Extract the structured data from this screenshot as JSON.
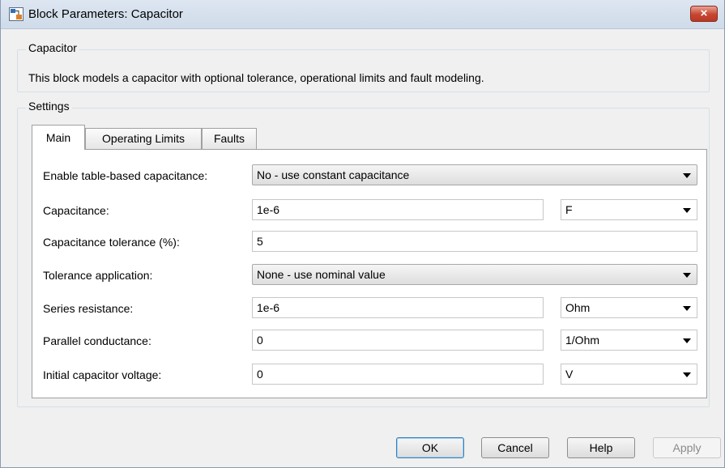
{
  "window": {
    "title": "Block Parameters: Capacitor",
    "close_label": "×"
  },
  "block_group": {
    "legend": "Capacitor",
    "description": "This block models a capacitor with optional tolerance, operational limits and fault modeling."
  },
  "settings_group": {
    "legend": "Settings"
  },
  "tabs": [
    {
      "label": "Main",
      "active": true
    },
    {
      "label": "Operating Limits",
      "active": false
    },
    {
      "label": "Faults",
      "active": false
    }
  ],
  "params": {
    "table_based": {
      "label": "Enable table-based capacitance:",
      "value": "No - use constant capacitance"
    },
    "capacitance": {
      "label": "Capacitance:",
      "value": "1e-6",
      "unit": "F"
    },
    "tolerance": {
      "label": "Capacitance tolerance (%):",
      "value": "5"
    },
    "tolerance_application": {
      "label": "Tolerance application:",
      "value": "None - use nominal value"
    },
    "series_resistance": {
      "label": "Series resistance:",
      "value": "1e-6",
      "unit": "Ohm"
    },
    "parallel_conductance": {
      "label": "Parallel conductance:",
      "value": "0",
      "unit": "1/Ohm"
    },
    "initial_voltage": {
      "label": "Initial capacitor voltage:",
      "value": "0",
      "unit": "V"
    }
  },
  "buttons": {
    "ok": "OK",
    "cancel": "Cancel",
    "help": "Help",
    "apply": "Apply"
  }
}
